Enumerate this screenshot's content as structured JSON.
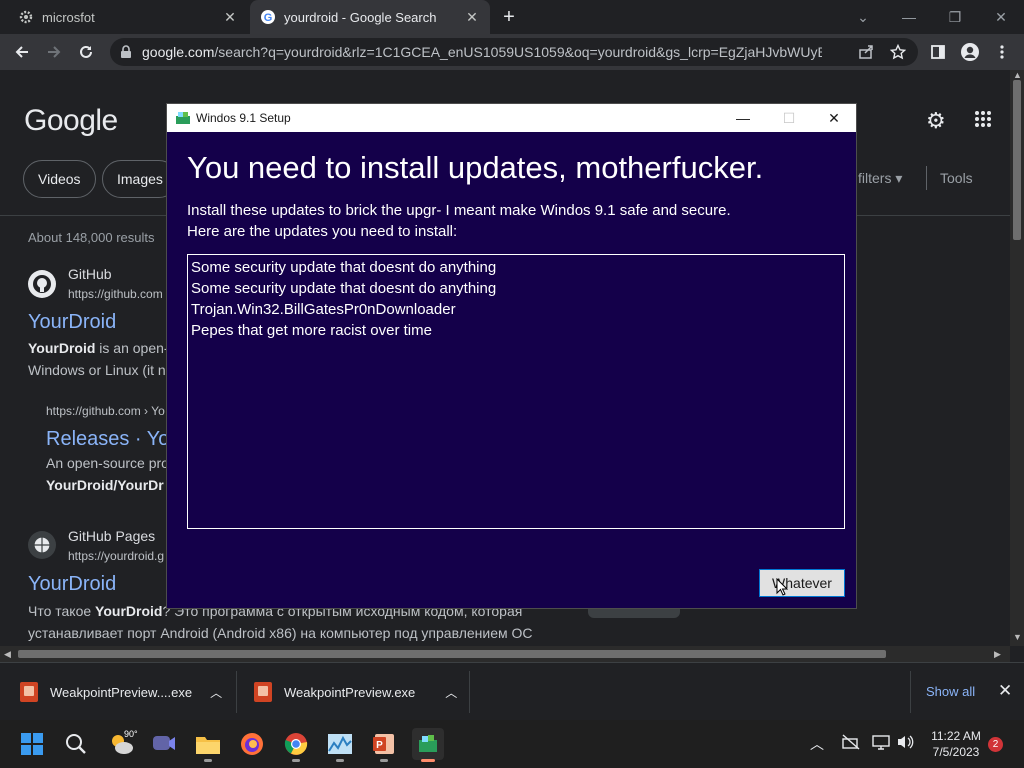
{
  "browser": {
    "tabs": [
      {
        "title": "microsfot",
        "close": "✕"
      },
      {
        "title": "yourdroid - Google Search",
        "close": "✕"
      }
    ],
    "new_tab": "+",
    "url_host": "google.com",
    "url_rest": "/search?q=yourdroid&rlz=1C1GCEA_enUS1059US1059&oq=yourdroid&gs_lcrp=EgZjaHJvbWUyBgg..."
  },
  "search_page": {
    "logo": "Google",
    "chips": [
      "Videos",
      "Images"
    ],
    "filters": "filters ▾",
    "tools": "Tools",
    "stats": "About 148,000 results",
    "results": [
      {
        "site_name": "GitHub",
        "site_url": "https://github.com",
        "title": "YourDroid",
        "snippet_bold": "YourDroid",
        "snippet_rest": " is an open-",
        "snippet_line2": "Windows or Linux (it n",
        "sub_url": "https://github.com › Yo",
        "sub_title": "Releases · Yo",
        "sub_snippet": "An open-source pro",
        "sub_snippet_bold": "YourDroid/YourDr"
      },
      {
        "site_name": "GitHub Pages",
        "site_url": "https://yourdroid.g",
        "title": "YourDroid",
        "snippet_pre": "Что такое ",
        "snippet_bold": "YourDroid",
        "snippet_rest": "? Это программа с открытым исходным кодом, которая",
        "snippet_line2": "устанавливает порт Android (Android x86) на компьютер под управлением ОС"
      }
    ]
  },
  "downloads": {
    "items": [
      {
        "name": "WeakpointPreview....exe"
      },
      {
        "name": "WeakpointPreview.exe"
      }
    ],
    "show_all": "Show all"
  },
  "taskbar": {
    "weather_temp": "90°",
    "time": "11:22 AM",
    "date": "7/5/2023",
    "notifications": "2"
  },
  "dialog": {
    "title": "Windos 9.1 Setup",
    "heading": "You need to install updates, motherfucker.",
    "description_line1": "Install these updates to brick the upgr- I meant make Windos 9.1 safe and secure.",
    "description_line2": "Here are the updates you need to install:",
    "updates": [
      "Some security update that doesnt do anything",
      "Some security update that doesnt do anything",
      "Trojan.Win32.BillGatesPr0nDownloader",
      "Pepes that get more racist over time"
    ],
    "button_label": "Whatever",
    "title_bg": "#ffffff",
    "body_bg": "#14004a"
  }
}
